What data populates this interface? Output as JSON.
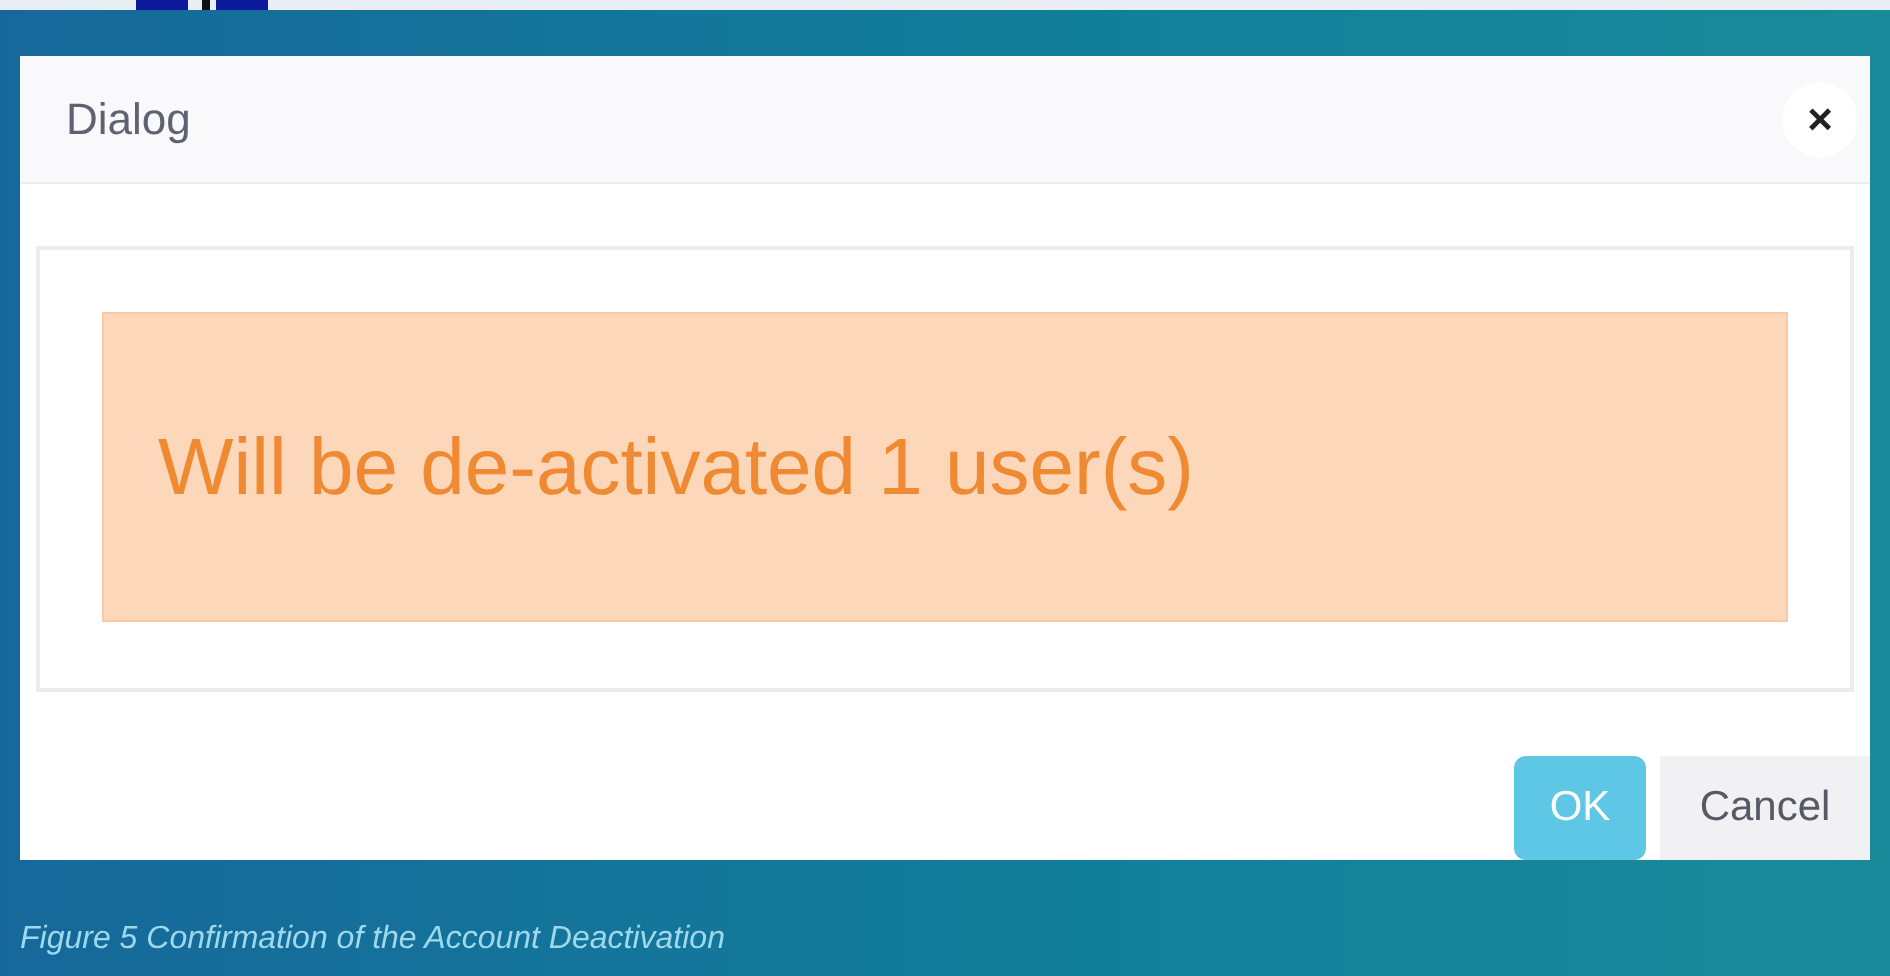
{
  "dialog": {
    "title": "Dialog",
    "close": "×",
    "message": "Will be de-activated 1 user(s)",
    "buttons": [
      {
        "label": "OK",
        "kind": "primary"
      },
      {
        "label": "Cancel",
        "kind": "secondary"
      }
    ]
  },
  "caption": "Figure 5 Confirmation of the Account Deactivation"
}
